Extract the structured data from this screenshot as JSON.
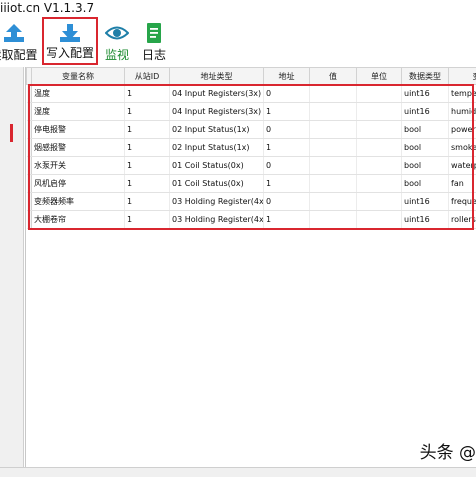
{
  "window": {
    "title": "iiiot.cn V1.1.3.7"
  },
  "toolbar": {
    "read_label": "读取配置",
    "write_label": "写入配置",
    "monitor_label": "监视",
    "log_label": "日志"
  },
  "table": {
    "columns": [
      "变量名称",
      "从站ID",
      "地址类型",
      "地址",
      "值",
      "单位",
      "数据类型",
      "变"
    ],
    "rows": [
      {
        "name": "温度",
        "slave": "1",
        "type": "04 Input Registers(3x)",
        "addr": "0",
        "value": "",
        "unit": "",
        "dtype": "uint16",
        "var": "temper"
      },
      {
        "name": "湿度",
        "slave": "1",
        "type": "04 Input Registers(3x)",
        "addr": "1",
        "value": "",
        "unit": "",
        "dtype": "uint16",
        "var": "humidi"
      },
      {
        "name": "停电报警",
        "slave": "1",
        "type": "02 Input Status(1x)",
        "addr": "0",
        "value": "",
        "unit": "",
        "dtype": "bool",
        "var": "powerfa"
      },
      {
        "name": "烟感报警",
        "slave": "1",
        "type": "02 Input Status(1x)",
        "addr": "1",
        "value": "",
        "unit": "",
        "dtype": "bool",
        "var": "smoke"
      },
      {
        "name": "水泵开关",
        "slave": "1",
        "type": "01 Coil Status(0x)",
        "addr": "0",
        "value": "",
        "unit": "",
        "dtype": "bool",
        "var": "waterpu"
      },
      {
        "name": "风机启停",
        "slave": "1",
        "type": "01 Coil Status(0x)",
        "addr": "1",
        "value": "",
        "unit": "",
        "dtype": "bool",
        "var": "fan"
      },
      {
        "name": "变频器频率",
        "slave": "1",
        "type": "03 Holding Register(4x)",
        "addr": "0",
        "value": "",
        "unit": "",
        "dtype": "uint16",
        "var": "frequen"
      },
      {
        "name": "大棚卷帘",
        "slave": "1",
        "type": "03 Holding Register(4x)",
        "addr": "1",
        "value": "",
        "unit": "",
        "dtype": "uint16",
        "var": "rollersh"
      }
    ]
  },
  "watermark": {
    "text": "头条 @"
  },
  "colors": {
    "highlight": "#d9262f",
    "monitor_label": "#1a8a2e",
    "icon_blue": "#2e8fd6",
    "icon_green": "#27a54a"
  }
}
